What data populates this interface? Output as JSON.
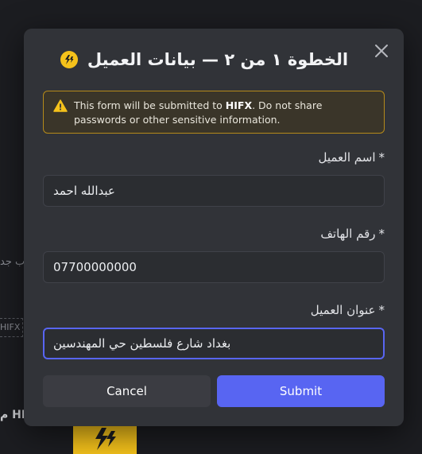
{
  "background": {
    "frag_1": "ب جد",
    "frag_2": "HIFX T",
    "frag_3": "م HFX"
  },
  "modal": {
    "title": "الخطوة ١ من ٢ — بيانات العميل",
    "logo_icon": "lightning-logo-icon",
    "close_icon": "close-icon",
    "warning": {
      "icon": "warning-triangle-icon",
      "text_before": "This form will be submitted to ",
      "brand": "HIFX",
      "text_after": ". Do not share passwords or other sensitive information."
    },
    "fields": [
      {
        "label": "اسم العميل",
        "required": "*",
        "value": "عبدالله احمد"
      },
      {
        "label": "رقم الهاتف",
        "required": "*",
        "value": "07700000000"
      },
      {
        "label": "عنوان العميل",
        "required": "*",
        "value": "بغداد شارع فلسطين حي المهندسين"
      }
    ],
    "buttons": {
      "cancel": "Cancel",
      "submit": "Submit"
    }
  },
  "colors": {
    "accent": "#5865f2",
    "brand": "#f5c21b",
    "warning_border": "#b58a1a"
  }
}
